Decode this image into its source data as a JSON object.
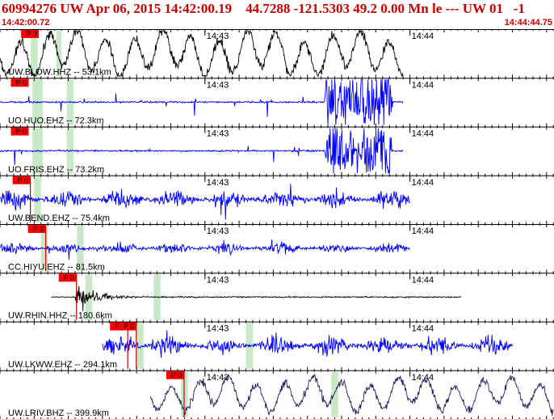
{
  "header": {
    "title": "60994276 UW Apr 06, 2015 14:42:00.19    44.7288 -121.5303 49.2 0.00 Mn le --- UW 01   -1",
    "start_time": "14:42:00.72",
    "end_time": "14:44:44.75"
  },
  "time_marks": [
    {
      "label": "14:43",
      "t": 60
    },
    {
      "label": "14:44",
      "t": 120
    }
  ],
  "traces": [
    {
      "label": "UW.BLOW.HHZ -- 53.1km",
      "color": "#000000",
      "start": 0,
      "end": 118,
      "amp": 0.55,
      "kind": "noise-long",
      "picks": [
        {
          "label": "P 0",
          "t": 9.5,
          "line": false
        }
      ],
      "green": [
        {
          "t0": 9.0,
          "t1": 11.0
        },
        {
          "t0": 16.5,
          "t1": 18.0
        }
      ]
    },
    {
      "label": "UO.HUO.EHZ -- 72.3km",
      "color": "#0000ff",
      "start": 0,
      "end": 118,
      "amp": 0.12,
      "kind": "spiky",
      "picks": [
        {
          "label": "P 0",
          "t": 6.5,
          "line": false
        }
      ],
      "green": [
        {
          "t0": 9.5,
          "t1": 12.5
        },
        {
          "t0": 19.5,
          "t1": 21.5
        }
      ]
    },
    {
      "label": "UO.FRIS.EHZ -- 73.2km",
      "color": "#0000ff",
      "start": 0,
      "end": 118,
      "amp": 0.12,
      "kind": "spiky",
      "picks": [
        {
          "label": "P 0",
          "t": 6.5,
          "line": false
        }
      ],
      "green": [
        {
          "t0": 9.5,
          "t1": 12.5
        },
        {
          "t0": 19.5,
          "t1": 21.5
        }
      ]
    },
    {
      "label": "UW.BEND.EHZ -- 75.4km",
      "color": "#0000ff",
      "start": 0,
      "end": 120,
      "amp": 0.35,
      "kind": "noise-short",
      "picks": [
        {
          "label": "P 0",
          "t": 7.0,
          "line": true
        }
      ],
      "green": [
        {
          "t0": 10.0,
          "t1": 12.0
        }
      ]
    },
    {
      "label": "CC.HIYU.EHZ -- 81.5km",
      "color": "#0000ff",
      "start": 0,
      "end": 120,
      "amp": 0.2,
      "kind": "noise-short",
      "picks": [
        {
          "label": "P 0",
          "t": 11.5,
          "line": true
        }
      ],
      "green": [
        {
          "t0": 12.0,
          "t1": 14.0
        },
        {
          "t0": 22.5,
          "t1": 24.5
        }
      ]
    },
    {
      "label": "UW.RHIN.HHZ -- 180.6km",
      "color": "#000000",
      "start": 15,
      "end": 135,
      "amp": 0.12,
      "kind": "event",
      "picks": [
        {
          "label": "P 0",
          "t": 20.5,
          "line": true
        }
      ],
      "green": [
        {
          "t0": 25.0,
          "t1": 27.0
        },
        {
          "t0": 45.0,
          "t1": 47.0
        }
      ]
    },
    {
      "label": "UW.LKWW.EHZ -- 294.1km",
      "color": "#0000ff",
      "start": 30,
      "end": 150,
      "amp": 0.35,
      "kind": "noise-short",
      "picks": [
        {
          "label": "P 0",
          "t": 35.5,
          "line": true
        },
        {
          "label": "P 0",
          "t": 38.0,
          "line": true
        }
      ],
      "green": [
        {
          "t0": 40.0,
          "t1": 42.0
        },
        {
          "t0": 72.0,
          "t1": 74.0
        }
      ]
    },
    {
      "label": "UW.LRIV.BHZ -- 399.9km",
      "color": "#2d1a5f",
      "start": 44,
      "end": 164,
      "amp": 0.4,
      "kind": "noise-long",
      "picks": [
        {
          "label": "P 0",
          "t": 52.0,
          "line": true
        }
      ],
      "green": [
        {
          "t0": 53.0,
          "t1": 55.0
        },
        {
          "t0": 97.0,
          "t1": 99.0
        }
      ]
    }
  ],
  "colors": {
    "pick_flag": "#ff0000",
    "pick_line": "#cc0000",
    "green_band": "#c8e8c8",
    "separator": "#000000"
  }
}
